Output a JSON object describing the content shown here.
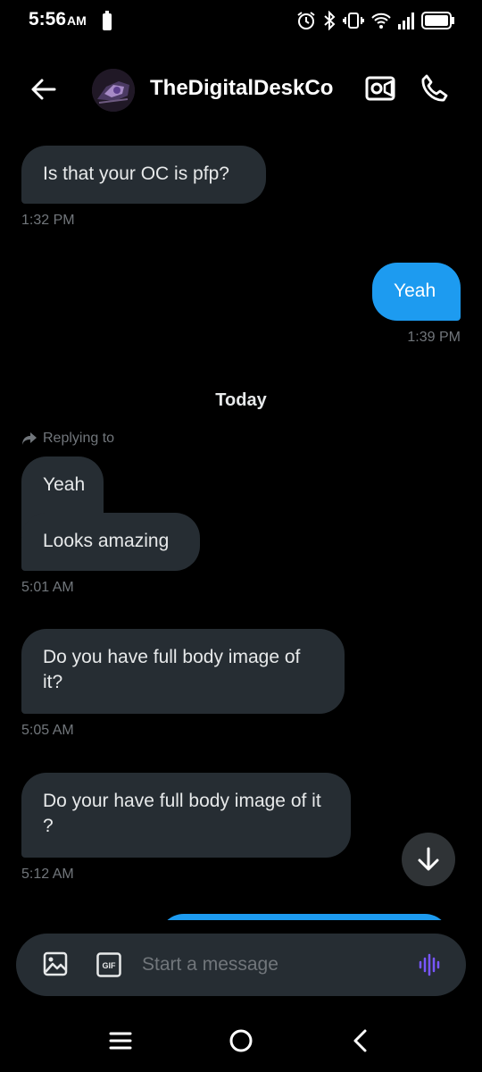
{
  "status_bar": {
    "time": "5:56",
    "ampm": "AM"
  },
  "header": {
    "contact_name": "TheDigitalDeskCo"
  },
  "messages": [
    {
      "text": "Is that your OC is pfp?",
      "time": "1:32 PM"
    },
    {
      "text": "Yeah",
      "time": "1:39 PM"
    },
    {
      "text": "Looks amazing",
      "time": "5:01 AM"
    },
    {
      "text": "Do you have full body image of it?",
      "time": "5:05 AM"
    },
    {
      "text": "Do your have full body image of it ?",
      "time": "5:12 AM"
    }
  ],
  "day_separator": "Today",
  "reply": {
    "label": "Replying to",
    "quoted_text": "Yeah"
  },
  "composer": {
    "placeholder": "Start a message",
    "gif_label": "GIF"
  },
  "colors": {
    "background": "#000000",
    "received_bubble": "#262d33",
    "sent_bubble": "#1d9bf0",
    "muted_text": "#71767b",
    "voice_accent": "#7856ff"
  }
}
